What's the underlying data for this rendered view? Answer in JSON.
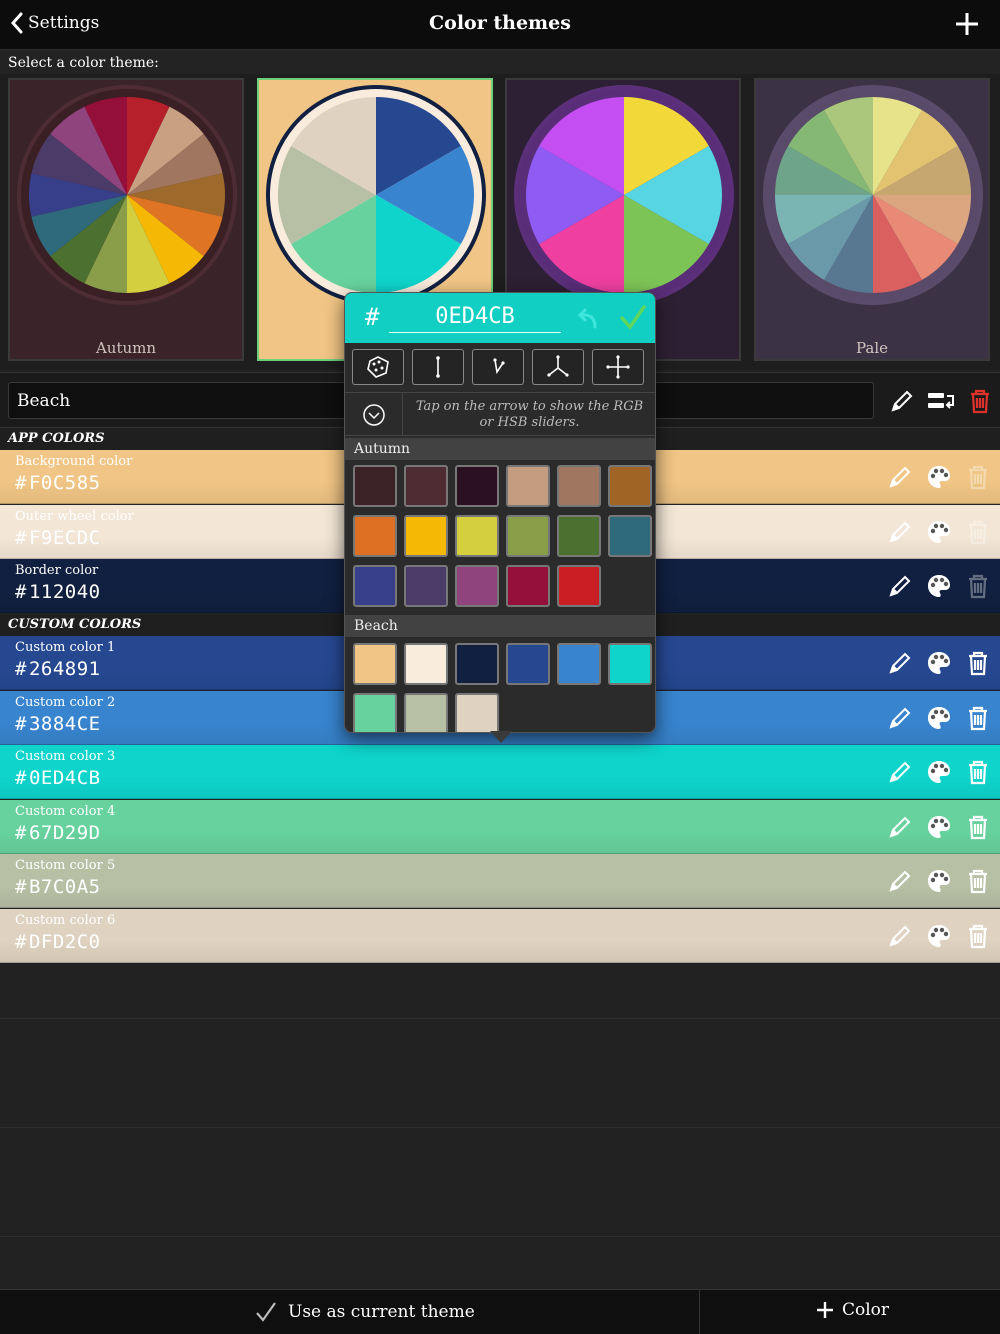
{
  "nav": {
    "back_label": "Settings",
    "title": "Color themes"
  },
  "select_label": "Select a color theme:",
  "themes": [
    {
      "name": "Autumn",
      "outer": "#3a1f24",
      "bg": "#3a2429",
      "ring": "#4e2c35",
      "slices": [
        "#b5202b",
        "#c7a182",
        "#a17660",
        "#9e6a2c",
        "#de7424",
        "#f5b905",
        "#d4cf3f",
        "#8a9e4a",
        "#4c702f",
        "#2f6a7c",
        "#373f8a",
        "#4b3b68",
        "#8f447d",
        "#940f39"
      ]
    },
    {
      "name": "Beach",
      "outer": "#f9ecdc",
      "bg": "#f0c585",
      "ring": "#112040",
      "slices": [
        "#264891",
        "#3884ce",
        "#0ed4cb",
        "#67d29d",
        "#b7c0a5",
        "#dfd2c0"
      ]
    },
    {
      "name": "",
      "outer": "#5a2d78",
      "bg": "#2e2034",
      "ring": "#5b2f7a",
      "slices": [
        "#f3d83a",
        "#58d5e2",
        "#7dc456",
        "#ef3fa0",
        "#8e5cf3",
        "#c44ef2"
      ]
    },
    {
      "name": "Pale",
      "outer": "#5a4a6a",
      "bg": "#3b3345",
      "ring": "#5b4b6a",
      "slices": [
        "#e6e38b",
        "#e2c470",
        "#c7a770",
        "#dba57f",
        "#e98a76",
        "#d9605e",
        "#587791",
        "#6a9aa9",
        "#7ab5b3",
        "#6ea48a",
        "#84b874",
        "#abc77b"
      ]
    }
  ],
  "theme_name_value": "Beach",
  "sections": {
    "app": "APP COLORS",
    "custom": "CUSTOM COLORS"
  },
  "app_colors": [
    {
      "label": "Background color",
      "hex": "F0C585",
      "bg": "#f0c585",
      "text": "#ffffff"
    },
    {
      "label": "Outer wheel color",
      "hex": "F9ECDC",
      "bg": "#f3e6d6",
      "text": "#ffffff"
    },
    {
      "label": "Border color",
      "hex": "112040",
      "bg": "#112040",
      "text": "#ffffff"
    }
  ],
  "custom_colors": [
    {
      "label": "Custom color 1",
      "hex": "264891",
      "bg": "#264891",
      "text": "#ffffff"
    },
    {
      "label": "Custom color 2",
      "hex": "3884CE",
      "bg": "#3884ce",
      "text": "#ffffff"
    },
    {
      "label": "Custom color 3",
      "hex": "0ED4CB",
      "bg": "#0ed4cb",
      "text": "#ffffff"
    },
    {
      "label": "Custom color 4",
      "hex": "67D29D",
      "bg": "#67d29d",
      "text": "#ffffff"
    },
    {
      "label": "Custom color 5",
      "hex": "B7C0A5",
      "bg": "#b7c0a5",
      "text": "#ffffff"
    },
    {
      "label": "Custom color 6",
      "hex": "DFD2C0",
      "bg": "#dfd2c0",
      "text": "#ffffff"
    }
  ],
  "popover": {
    "hash": "#",
    "hex_value": "0ED4CB",
    "hint": "Tap on the arrow to show the RGB or HSB sliders.",
    "palettes": [
      {
        "name": "Autumn",
        "swatches": [
          "#3a2226",
          "#4f2c33",
          "#2a1020",
          "#c49c80",
          "#a07660",
          "#a06424",
          "#de7024",
          "#f5b905",
          "#d4cf3f",
          "#8a9e4a",
          "#4c702f",
          "#2f6a7c",
          "#373f8a",
          "#4b3b68",
          "#8f447d",
          "#940f39",
          "#c91f24"
        ]
      },
      {
        "name": "Beach",
        "swatches": [
          "#f0c585",
          "#f9ecdc",
          "#112040",
          "#264891",
          "#3884ce",
          "#0ed4cb",
          "#67d29d",
          "#b7c0a5",
          "#dfd2c0"
        ]
      }
    ]
  },
  "bottom": {
    "use_label": "Use as current theme",
    "add_label": "Color"
  },
  "colors": {
    "delete_red": "#e0322b",
    "accent_green": "#6fd07a"
  }
}
